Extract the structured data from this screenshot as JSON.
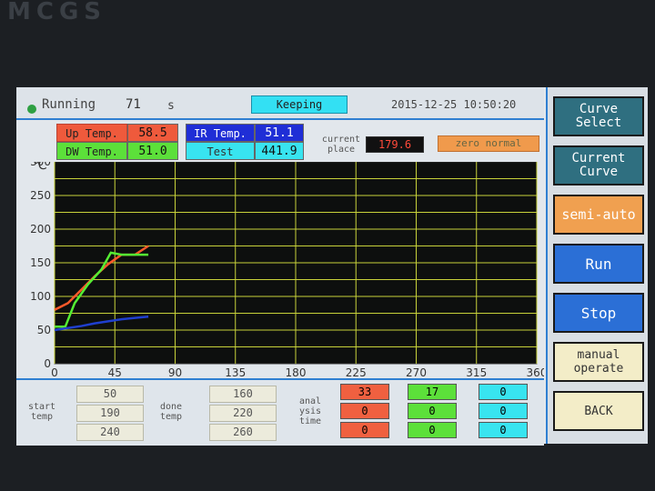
{
  "brand": "MCGS",
  "status": {
    "label": "Running",
    "seconds": "71",
    "unit": "s",
    "state": "Keeping",
    "datetime": "2015-12-25 10:50:20"
  },
  "readings": {
    "up_label": "Up Temp.",
    "up_value": "58.5",
    "dw_label": "DW Temp.",
    "dw_value": "51.0",
    "ir_label": "IR Temp.",
    "ir_value": "51.1",
    "test_label": "Test",
    "test_value": "441.9",
    "current_label_1": "current",
    "current_label_2": "place",
    "current_value": "179.6",
    "zero_label": "zero normal"
  },
  "chart_data": {
    "type": "line",
    "ylabel": "℃",
    "xlim": [
      0,
      360
    ],
    "ylim": [
      0,
      300
    ],
    "xticks": [
      0,
      45,
      90,
      135,
      180,
      225,
      270,
      315,
      360
    ],
    "yticks": [
      0,
      50,
      100,
      150,
      200,
      250,
      300
    ],
    "grid": true,
    "series": [
      {
        "color": "#ff5a2a",
        "x": [
          0,
          10,
          20,
          30,
          40,
          50,
          60,
          70
        ],
        "y": [
          80,
          90,
          110,
          130,
          148,
          162,
          162,
          175
        ]
      },
      {
        "color": "#55ee33",
        "x": [
          0,
          8,
          15,
          25,
          35,
          42,
          50,
          60,
          70
        ],
        "y": [
          55,
          55,
          90,
          118,
          140,
          165,
          162,
          162,
          162
        ]
      },
      {
        "color": "#1f3fcf",
        "x": [
          0,
          10,
          20,
          30,
          40,
          50,
          60,
          70
        ],
        "y": [
          50,
          53,
          56,
          60,
          63,
          66,
          68,
          70
        ]
      }
    ]
  },
  "bottom": {
    "start_1": "start",
    "start_2": "temp",
    "start_values": [
      "50",
      "190",
      "240"
    ],
    "done_1": "done",
    "done_2": "temp",
    "done_values": [
      "160",
      "220",
      "260"
    ],
    "anal_1": "anal",
    "anal_2": "ysis",
    "anal_3": "time",
    "red": [
      "33",
      "0",
      "0"
    ],
    "green": [
      "17",
      "0",
      "0"
    ],
    "cyan": [
      "0",
      "0",
      "0"
    ]
  },
  "buttons": {
    "curve_select_1": "Curve",
    "curve_select_2": "Select",
    "current_curve_1": "Current",
    "current_curve_2": "Curve",
    "semi_auto": "semi-auto",
    "run": "Run",
    "stop": "Stop",
    "manual_1": "manual",
    "manual_2": "operate",
    "back": "BACK"
  },
  "colors": {
    "accent_blue": "#2f7fd1",
    "teal_btn": "#2f6f80",
    "blue_btn": "#2b6fd6",
    "orange_btn": "#f0a050",
    "cream_btn": "#f3edc8"
  }
}
